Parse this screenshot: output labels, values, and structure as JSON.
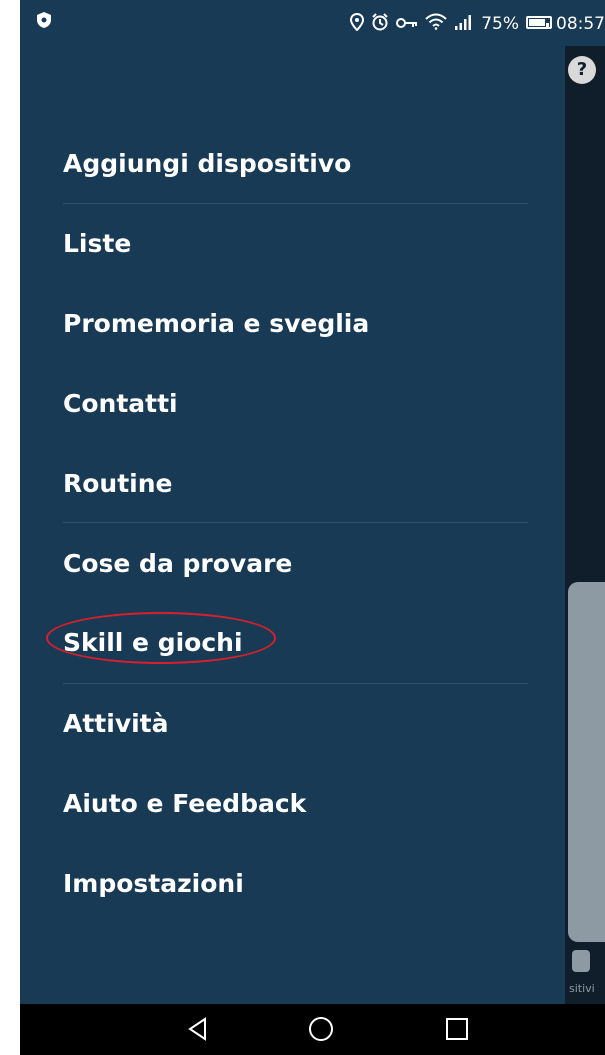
{
  "status_bar": {
    "battery_percent": "75%",
    "time": "08:57",
    "icons": [
      "shield-icon",
      "location-icon",
      "alarm-icon",
      "vpn-key-icon",
      "wifi-icon",
      "signal-icon",
      "battery-icon"
    ]
  },
  "menu": {
    "items": [
      {
        "label": "Aggiungi dispositivo"
      },
      {
        "label": "Liste"
      },
      {
        "label": "Promemoria e sveglia"
      },
      {
        "label": "Contatti"
      },
      {
        "label": "Routine"
      },
      {
        "label": "Cose da provare"
      },
      {
        "label": "Skill e giochi",
        "highlighted": true
      },
      {
        "label": "Attività"
      },
      {
        "label": "Aiuto e Feedback"
      },
      {
        "label": "Impostazioni"
      }
    ]
  },
  "background": {
    "help_symbol": "?",
    "device_label": "sitivi"
  },
  "nav_bar": {
    "buttons": [
      "back-icon",
      "home-icon",
      "recents-icon"
    ]
  },
  "colors": {
    "drawer": "#193a55",
    "divider": "#2f5272",
    "highlight": "#d9202a",
    "nav_bar": "#000000"
  }
}
